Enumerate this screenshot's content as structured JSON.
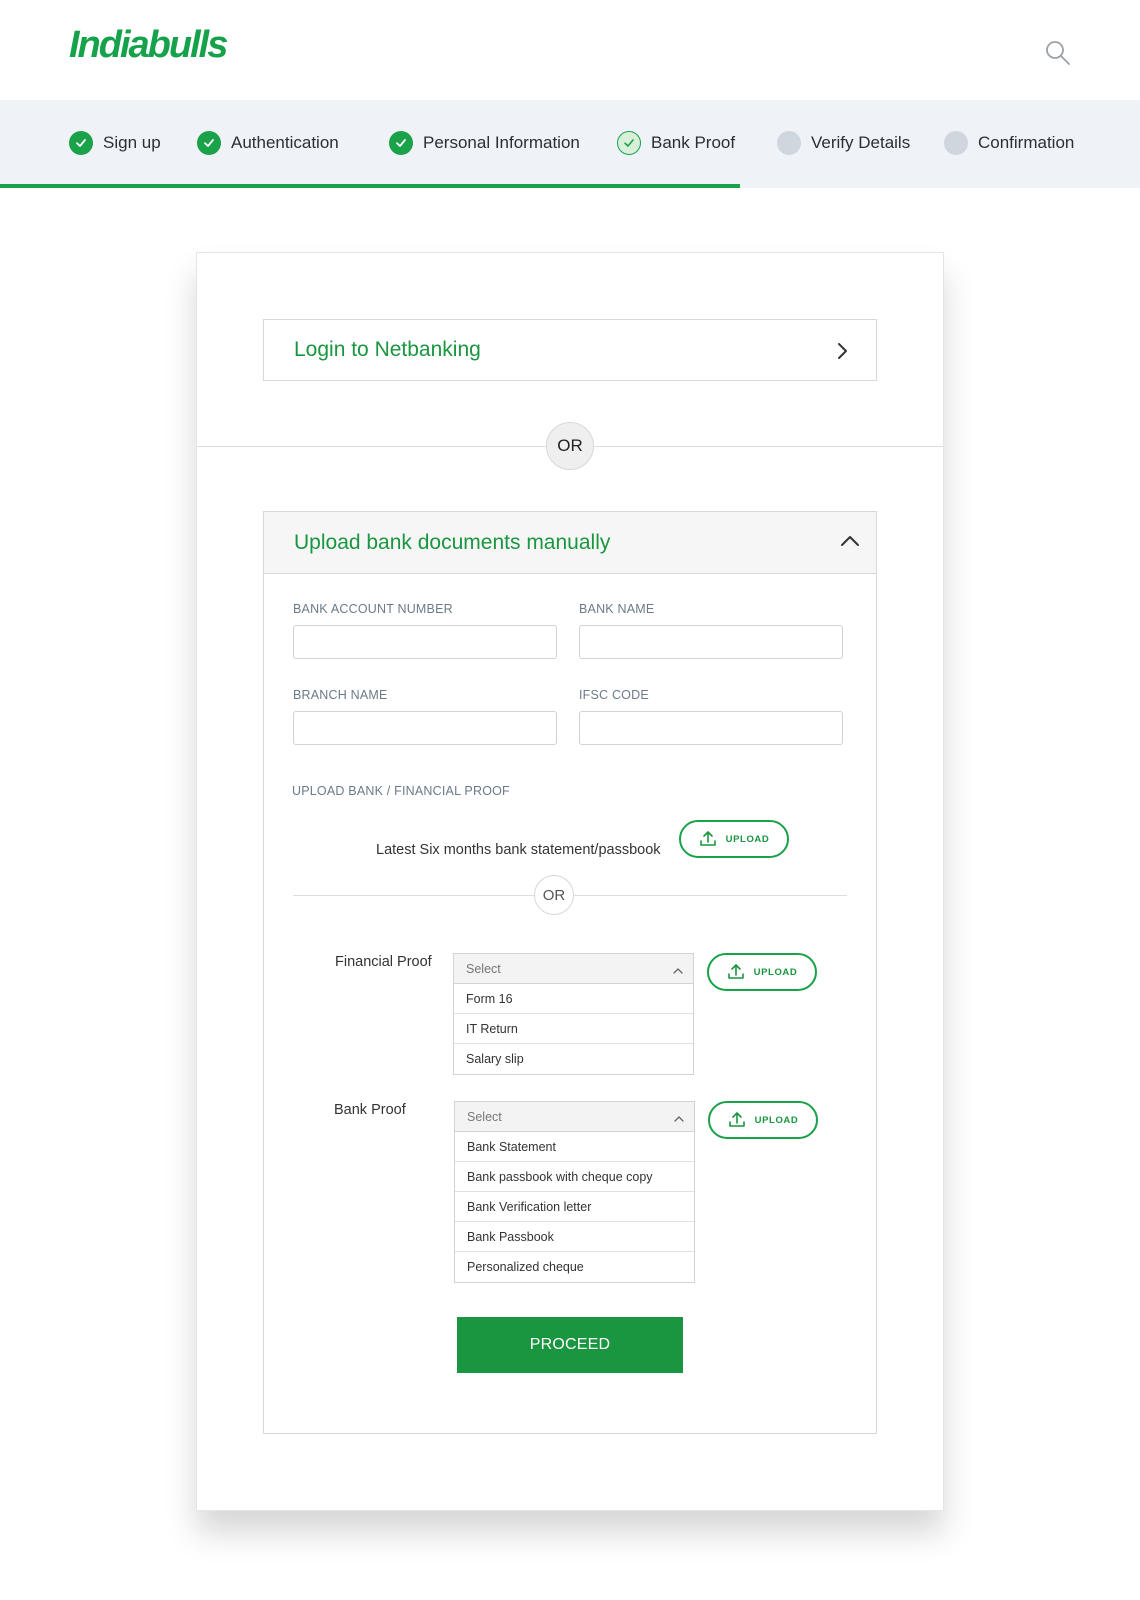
{
  "header": {
    "logo": "Indiabulls",
    "search_icon": "search-icon"
  },
  "steps": [
    {
      "label": "Sign up",
      "status": "done"
    },
    {
      "label": "Authentication",
      "status": "done"
    },
    {
      "label": "Personal Information",
      "status": "done"
    },
    {
      "label": "Bank Proof",
      "status": "current"
    },
    {
      "label": "Verify Details",
      "status": "todo"
    },
    {
      "label": "Confirmation",
      "status": "todo"
    }
  ],
  "colors": {
    "accent": "#19a24a",
    "step_bar_bg": "#eff3f7",
    "inactive_step": "#cfd6de"
  },
  "netbanking": {
    "title": "Login to Netbanking"
  },
  "or_label": "OR",
  "manual": {
    "title": "Upload bank documents manually",
    "fields": {
      "account_number_label": "BANK ACCOUNT NUMBER",
      "bank_name_label": "BANK NAME",
      "branch_name_label": "BRANCH NAME",
      "ifsc_label": "IFSC CODE"
    },
    "upload_section_label": "UPLOAD BANK / FINANCIAL PROOF",
    "statement_text": "Latest Six months bank statement/passbook",
    "upload_label": "UPLOAD",
    "or_label": "OR",
    "financial_proof": {
      "label": "Financial Proof",
      "placeholder": "Select",
      "options": [
        "Form 16",
        "IT Return",
        "Salary slip"
      ]
    },
    "bank_proof": {
      "label": "Bank Proof",
      "placeholder": "Select",
      "options": [
        "Bank Statement",
        "Bank passbook with cheque copy",
        "Bank Verification letter",
        "Bank Passbook",
        "Personalized cheque"
      ]
    },
    "proceed_label": "PROCEED"
  }
}
